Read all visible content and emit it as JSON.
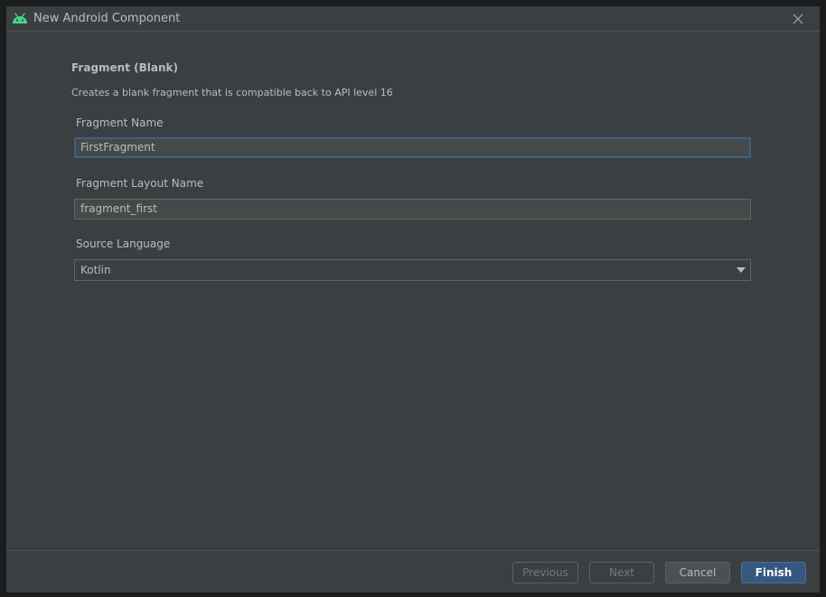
{
  "window": {
    "title": "New Android Component",
    "app_icon": "android-icon",
    "close_icon": "close-icon"
  },
  "form": {
    "heading": "Fragment (Blank)",
    "description": "Creates a blank fragment that is compatible back to API level 16",
    "fragment_name": {
      "label": "Fragment Name",
      "value": "FirstFragment"
    },
    "layout_name": {
      "label": "Fragment Layout Name",
      "value": "fragment_first"
    },
    "source_language": {
      "label": "Source Language",
      "value": "Kotlin"
    }
  },
  "footer": {
    "previous_label": "Previous",
    "next_label": "Next",
    "cancel_label": "Cancel",
    "finish_label": "Finish"
  },
  "colors": {
    "background": "#3c3f41",
    "text": "#bbbbbb",
    "focus_border": "#3d6185",
    "primary_button": "#365880",
    "android_green": "#3ddc84"
  }
}
